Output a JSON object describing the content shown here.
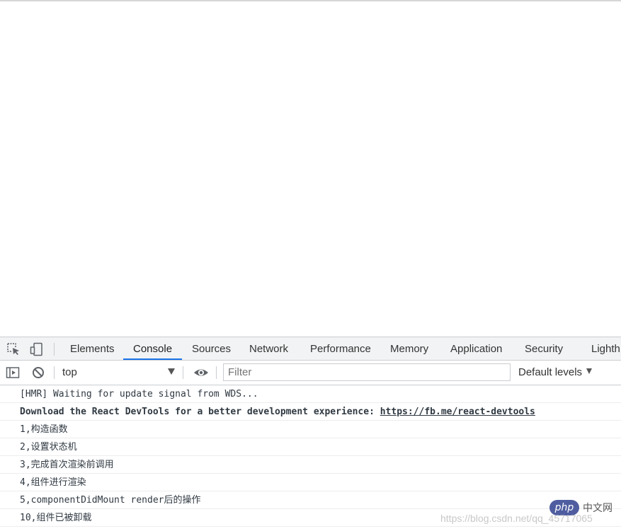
{
  "devtools": {
    "tabs": [
      {
        "label": "Elements",
        "active": false
      },
      {
        "label": "Console",
        "active": true
      },
      {
        "label": "Sources",
        "active": false
      },
      {
        "label": "Network",
        "active": false
      },
      {
        "label": "Performance",
        "active": false
      },
      {
        "label": "Memory",
        "active": false
      },
      {
        "label": "Application",
        "active": false
      },
      {
        "label": "Security",
        "active": false
      },
      {
        "label": "Lighth",
        "active": false
      }
    ],
    "accent_color": "#1a73e8",
    "toolbar_icons": [
      "inspect-element-icon",
      "device-toolbar-icon"
    ],
    "console_toolbar": {
      "sidebar_icon": "show-sidebar-icon",
      "clear_icon": "clear-console-icon",
      "context": "top",
      "eye_icon": "live-expression-icon",
      "filter_placeholder": "Filter",
      "filter_value": "",
      "levels": "Default levels"
    }
  },
  "console": {
    "messages": [
      {
        "text": "[HMR] Waiting for update signal from WDS...",
        "bold": false
      },
      {
        "text": "Download the React DevTools for a better development experience: ",
        "link": "https://fb.me/react-devtools",
        "bold": true
      },
      {
        "text": "1,构造函数",
        "bold": false
      },
      {
        "text": "2,设置状态机",
        "bold": false
      },
      {
        "text": "3,完成首次渲染前调用",
        "bold": false
      },
      {
        "text": "4,组件进行渲染",
        "bold": false
      },
      {
        "text": "5,componentDidMount render后的操作",
        "bold": false
      },
      {
        "text": "10,组件已被卸载",
        "bold": false
      }
    ]
  },
  "watermark": {
    "badge": "php",
    "site": "中文网",
    "url": "https://blog.csdn.net/qq_45717065"
  }
}
